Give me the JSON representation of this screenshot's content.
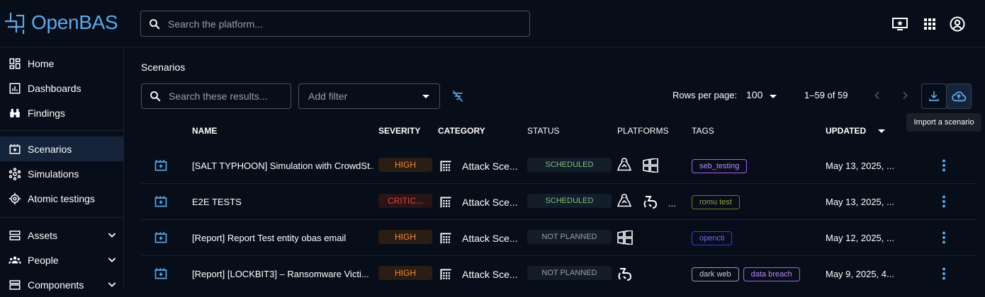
{
  "app": {
    "brand": "OpenBAS",
    "accent": "#5fa8e6"
  },
  "topbar": {
    "search_placeholder": "Search the platform...",
    "icons": [
      "screen-star-icon",
      "apps-grid-icon",
      "account-icon"
    ]
  },
  "sidebar": {
    "items": [
      {
        "label": "Home",
        "icon": "dashboard-grid-icon"
      },
      {
        "label": "Dashboards",
        "icon": "chart-icon"
      },
      {
        "label": "Findings",
        "icon": "binoculars-icon"
      },
      {
        "label": "Scenarios",
        "icon": "movie-filter-icon",
        "active": true
      },
      {
        "label": "Simulations",
        "icon": "hub-icon"
      },
      {
        "label": "Atomic testings",
        "icon": "target-icon"
      },
      {
        "label": "Assets",
        "icon": "assets-icon",
        "expandable": true
      },
      {
        "label": "People",
        "icon": "people-icon",
        "expandable": true
      },
      {
        "label": "Components",
        "icon": "components-icon",
        "expandable": true
      }
    ]
  },
  "main": {
    "title": "Scenarios",
    "search_placeholder": "Search these results...",
    "add_filter": "Add filter",
    "rows_per_page_label": "Rows per page:",
    "rows_per_page": "100",
    "range": "1–59 of 59",
    "tooltip": "Import a scenario",
    "columns": {
      "name": "NAME",
      "severity": "SEVERITY",
      "category": "CATEGORY",
      "status": "STATUS",
      "platforms": "PLATFORMS",
      "tags": "TAGS",
      "updated": "UPDATED"
    },
    "rows": [
      {
        "name": "[SALT TYPHOON] Simulation with CrowdSt...",
        "severity": "HIGH",
        "category": "Attack Sce...",
        "status": "SCHEDULED",
        "platforms": [
          "linux-icon",
          "windows-icon"
        ],
        "platforms_more": "",
        "tags": [
          {
            "label": "seb_testing",
            "color": "#a463f2"
          }
        ],
        "updated": "May 13, 2025, ..."
      },
      {
        "name": "E2E TESTS",
        "severity": "CRITIC...",
        "category": "Attack Sce...",
        "status": "SCHEDULED",
        "platforms": [
          "linux-icon",
          "macos-icon"
        ],
        "platforms_more": "...",
        "tags": [
          {
            "label": "romu test",
            "color": "#6e7a2a"
          }
        ],
        "updated": "May 13, 2025, ..."
      },
      {
        "name": "[Report] Report Test entity obas email",
        "severity": "HIGH",
        "category": "Attack Sce...",
        "status": "NOT PLANNED",
        "platforms": [
          "windows-icon"
        ],
        "platforms_more": "",
        "tags": [
          {
            "label": "opencti",
            "color": "#3d3dd6"
          }
        ],
        "updated": "May 12, 2025, ..."
      },
      {
        "name": "[Report] [LOCKBIT3] – Ransomware Victi...",
        "severity": "HIGH",
        "category": "Attack Sce...",
        "status": "NOT PLANNED",
        "platforms": [
          "macos-icon"
        ],
        "platforms_more": "",
        "tags": [
          {
            "label": "dark web",
            "color": "#9aa0aa"
          },
          {
            "label": "data breach",
            "color": "#a463f2"
          }
        ],
        "updated": "May 9, 2025, 4..."
      }
    ]
  },
  "colors": {
    "high": "#f58b3b",
    "critical": "#e84545",
    "scheduled": "#7cc27c",
    "not_planned": "#9aa0aa"
  }
}
